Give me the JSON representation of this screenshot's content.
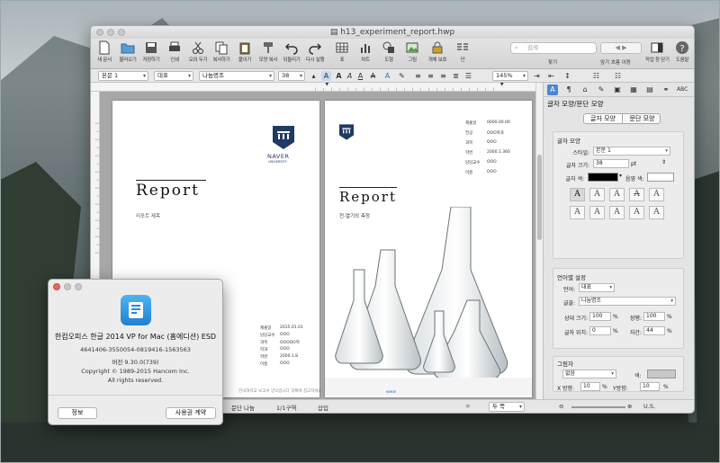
{
  "window": {
    "title": "h13_experiment_report.hwp"
  },
  "toolbar": {
    "items": [
      {
        "label": "새 문서",
        "icon": "new-document-icon"
      },
      {
        "label": "불러오기",
        "icon": "open-folder-icon"
      },
      {
        "label": "저장하기",
        "icon": "save-icon"
      },
      {
        "label": "인쇄",
        "icon": "print-icon"
      },
      {
        "label": "오려 두기",
        "icon": "cut-icon"
      },
      {
        "label": "복사하기",
        "icon": "copy-icon"
      },
      {
        "label": "붙이기",
        "icon": "paste-icon"
      },
      {
        "label": "모양 복사",
        "icon": "format-copy-icon"
      },
      {
        "label": "되돌리기",
        "icon": "undo-icon"
      },
      {
        "label": "다시 실행",
        "icon": "redo-icon"
      },
      {
        "label": "표",
        "icon": "table-icon"
      },
      {
        "label": "차트",
        "icon": "chart-icon"
      },
      {
        "label": "도형",
        "icon": "shape-icon"
      },
      {
        "label": "그림",
        "icon": "picture-icon"
      },
      {
        "label": "개체 보호",
        "icon": "lock-icon"
      },
      {
        "label": "단",
        "icon": "columns-icon"
      }
    ],
    "search_placeholder": "검색",
    "search_label": "찾기",
    "nav_label": "앞기 흐름 이동",
    "panel_toggle_label": "작업 창 닫기",
    "help_label": "도움말"
  },
  "format": {
    "style": "본문 1",
    "font_lang": "대표",
    "font": "나눔명조",
    "size": "38",
    "zoom": "145%"
  },
  "page1": {
    "title": "Report",
    "subtitle": "리포트 제목",
    "logo_text": "NAVER",
    "logo_sub": "UNIVERSITY",
    "info": [
      "제출일",
      "담당교수",
      "과목",
      "학과",
      "학번",
      "이름"
    ],
    "info_values": [
      "2015.01.01",
      "OOO",
      "OOOOO학",
      "OOO",
      "2000.1.8",
      "OOO"
    ],
    "footer": "한국대학교 보고서 양식입니다 과제에 참고하세요"
  },
  "page2": {
    "title": "Report",
    "subtitle": "전-열기의 측정",
    "info_labels": [
      "제출일",
      "전공",
      "과목",
      "학번",
      "담당교수",
      "이름"
    ],
    "info_values": [
      "0000.00.00",
      "OOO학과",
      "OOO",
      "2000.1.360",
      "OOO",
      "OOO"
    ]
  },
  "status": {
    "section": "문단 나눔",
    "page": "1/1구역",
    "mode": "삽입",
    "zoom_mode": "두 쪽",
    "lang": "U.S."
  },
  "panel": {
    "title": "글자 모양/문단 모양",
    "tab_char": "글자 모양",
    "tab_para": "문단 모양",
    "char_section": "글자 모양",
    "style_label": "스타일:",
    "style_value": "본문 1",
    "size_label": "글자 크기:",
    "size_value": "38",
    "size_unit": "pt",
    "color_label": "글자 색:",
    "shade_label": "음영 색:",
    "glyphs": [
      "A",
      "A",
      "A",
      "A",
      "A",
      "A",
      "A",
      "A",
      "A",
      "A"
    ],
    "lang_section": "언어별 설정",
    "lang_label": "언어:",
    "lang_value": "대표",
    "font_label": "글꼴:",
    "font_value": "나눔명조",
    "ratio_label": "상대 크기:",
    "ratio_value": "100",
    "width_label": "장평:",
    "width_value": "100",
    "pos_label": "글자 위치:",
    "pos_value": "0",
    "spacing_label": "자간:",
    "spacing_value": "44",
    "percent": "%",
    "shadow_section": "그림자",
    "shadow_value": "없음",
    "shadow_color_label": "색:",
    "x_label": "X 방향:",
    "x_value": "10",
    "y_label": "Y방향:",
    "y_value": "10",
    "under_section": "밑줄"
  },
  "about": {
    "app_name": "한컴오피스 한글 2014 VP for Mac (홈에디션) ESD",
    "serial": "4641406-3550054-0819416-1563563",
    "version": "버전 9.30.0(739)",
    "copyright": "Copyright © 1989-2015 Hancom Inc.",
    "rights": "All rights reserved.",
    "info_button": "정보",
    "license_button": "사용권 계약"
  },
  "colors": {
    "accent": "#2f73c9",
    "logo_navy": "#1f3a63",
    "app_icon": "#2a8ad9"
  }
}
